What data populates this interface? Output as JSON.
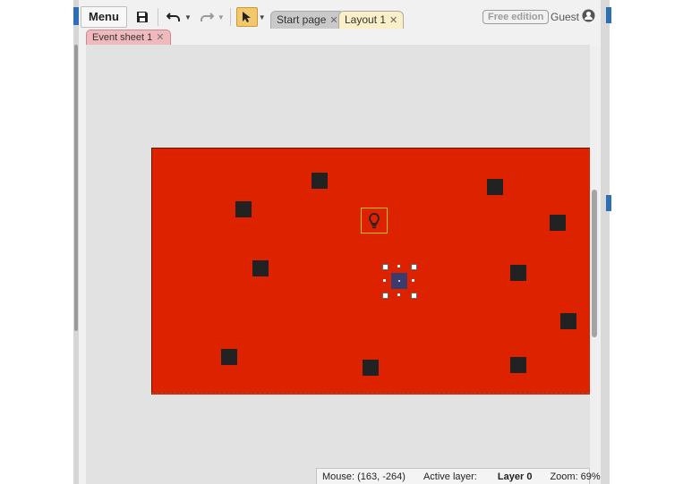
{
  "toolbar": {
    "menu_label": "Menu",
    "icons": [
      "save-icon",
      "undo-icon",
      "redo-icon",
      "pointer-icon"
    ]
  },
  "tabs": [
    {
      "label": "Start page",
      "active": false
    },
    {
      "label": "Layout 1",
      "active": true
    }
  ],
  "edition_badge": "Free edition",
  "user": {
    "name": "Guest",
    "icon": "user-icon"
  },
  "event_sheet_tab": {
    "label": "Event sheet 1"
  },
  "layout": {
    "background_color": "#dd2200",
    "block_color": "#222222",
    "player_color": "#3b3b6e",
    "light_icon": "lightbulb-icon"
  },
  "status_bar": {
    "mouse": "Mouse: (163, -264)",
    "active_layer_label": "Active layer:",
    "active_layer_value": "Layer 0",
    "zoom": "Zoom: 69%"
  }
}
